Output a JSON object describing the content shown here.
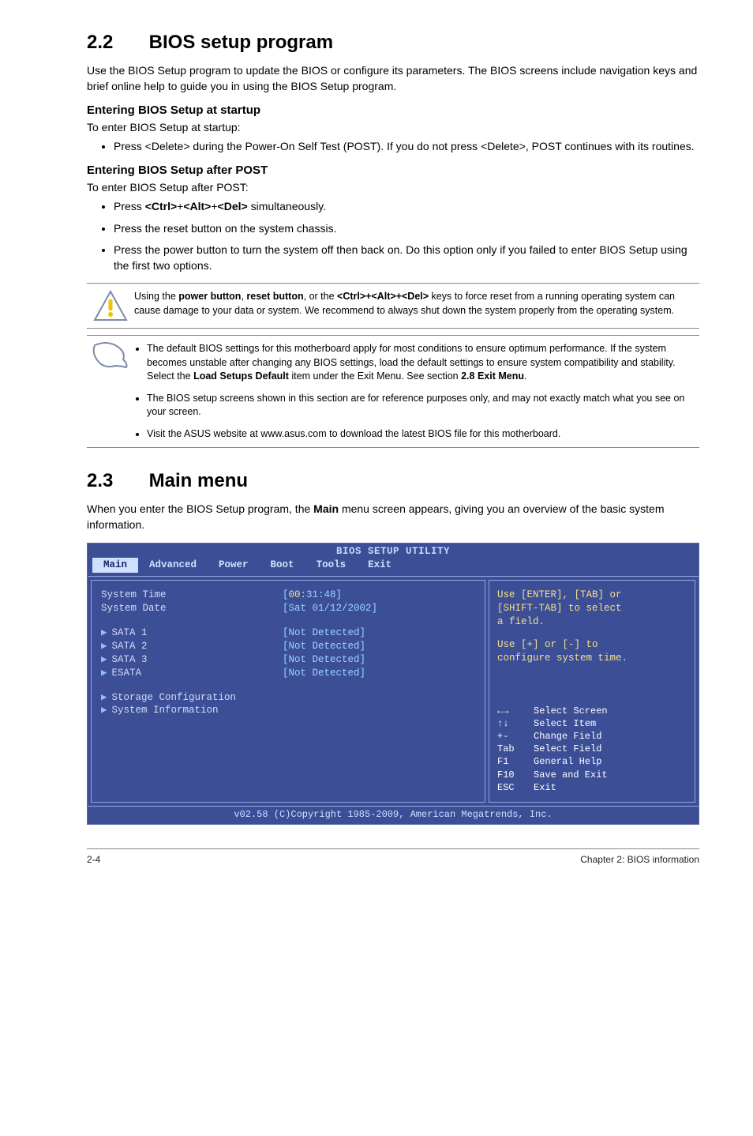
{
  "s22": {
    "num": "2.2",
    "title": "BIOS setup program",
    "intro": "Use the BIOS Setup program to update the BIOS or configure its parameters. The BIOS screens include navigation keys and brief online help to guide you in using the BIOS Setup program.",
    "startup_head": "Entering BIOS Setup at startup",
    "startup_lead": "To enter BIOS Setup at startup:",
    "startup_item": "Press <Delete> during the Power-On Self Test (POST). If you do not press <Delete>, POST continues with its routines.",
    "post_head": "Entering BIOS Setup after POST",
    "post_lead": "To enter BIOS Setup after POST:",
    "post_items": {
      "a_pre": "Press ",
      "a_keys_1": "<Ctrl>",
      "a_plus_1": "+",
      "a_keys_2": "<Alt>",
      "a_plus_2": "+",
      "a_keys_3": "<Del>",
      "a_post": " simultaneously.",
      "b": "Press the reset button on the system chassis.",
      "c": "Press the power button to turn the system off then back on. Do this option only if you failed to enter BIOS Setup using the first two options."
    }
  },
  "warn": {
    "pre": "Using the ",
    "b1": "power button",
    "mid1": ", ",
    "b2": "reset button",
    "mid2": ", or the ",
    "b3": "<Ctrl>+<Alt>+<Del>",
    "post": " keys to force reset from a running operating system can cause damage to your data or system. We recommend to always shut down the system properly from the operating system."
  },
  "notes": {
    "a_pre": "The default BIOS settings for this motherboard apply for most conditions to ensure optimum performance. If the system becomes unstable after changing any BIOS settings, load the default settings to ensure system compatibility and stability. Select the ",
    "a_b1": "Load Setups Default",
    "a_mid": " item under the Exit Menu. See section ",
    "a_b2": "2.8 Exit Menu",
    "a_post": ".",
    "b": "The BIOS setup screens shown in this section are for reference purposes only, and may not exactly match what you see on your screen.",
    "c": "Visit the ASUS website at www.asus.com to download the latest BIOS file for this motherboard."
  },
  "s23": {
    "num": "2.3",
    "title": "Main menu",
    "intro_pre": "When you enter the BIOS Setup program, the ",
    "intro_b": "Main",
    "intro_post": " menu screen appears, giving you an overview of the basic system information."
  },
  "bios": {
    "title": "BIOS SETUP UTILITY",
    "menu": {
      "main": "Main",
      "adv": "Advanced",
      "power": "Power",
      "boot": "Boot",
      "tools": "Tools",
      "exit": "Exit"
    },
    "left": {
      "systime_lbl": "System Time",
      "systime_val_a": "[",
      "systime_val_b": "00",
      "systime_val_c": ":31:48]",
      "sysdate_lbl": "System Date",
      "sysdate_val": "[Sat 01/12/2002]",
      "sata1": "SATA 1",
      "sata1_v": "[Not Detected]",
      "sata2": "SATA 2",
      "sata2_v": "[Not Detected]",
      "sata3": "SATA 3",
      "sata3_v": "[Not Detected]",
      "esata": "ESATA",
      "esata_v": "[Not Detected]",
      "storage": "Storage Configuration",
      "sysinfo": "System Information"
    },
    "right": {
      "l1": "Use [ENTER], [TAB] or",
      "l2": "[SHIFT-TAB] to select",
      "l3": "a field.",
      "l4": "Use [+] or [-] to",
      "l5": "configure system time.",
      "keys": {
        "arrows_lr": "←→",
        "arrows_lr_d": "Select Screen",
        "arrows_ud": "↑↓",
        "arrows_ud_d": "Select Item",
        "pm": "+-",
        "pm_d": "Change Field",
        "tab": "Tab",
        "tab_d": "Select Field",
        "f1": "F1",
        "f1_d": "General Help",
        "f10": "F10",
        "f10_d": "Save and Exit",
        "esc": "ESC",
        "esc_d": "Exit"
      }
    },
    "footer": "v02.58 (C)Copyright 1985-2009, American Megatrends, Inc."
  },
  "footer": {
    "left": "2-4",
    "right": "Chapter 2: BIOS information"
  }
}
